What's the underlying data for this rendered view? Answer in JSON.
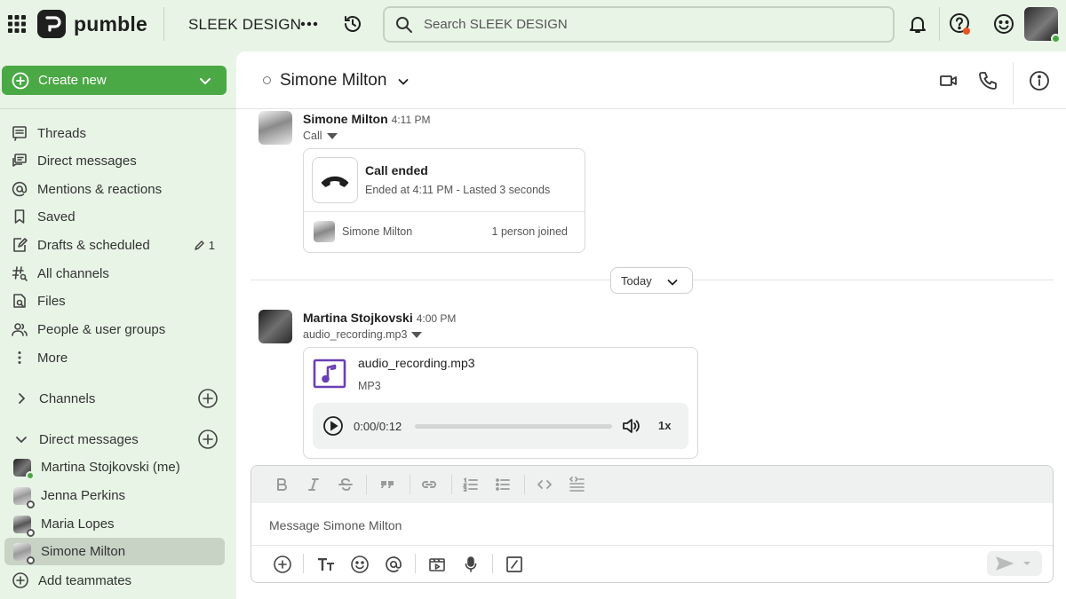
{
  "app": {
    "logo_text": "pumble",
    "workspace": "SLEEK DESIGN"
  },
  "search": {
    "placeholder": "Search SLEEK DESIGN"
  },
  "sidebar": {
    "create_label": "Create new",
    "items": [
      {
        "label": "Threads",
        "icon": "threads-icon"
      },
      {
        "label": "Direct messages",
        "icon": "direct-messages-icon"
      },
      {
        "label": "Mentions & reactions",
        "icon": "at-icon"
      },
      {
        "label": "Saved",
        "icon": "bookmark-icon"
      },
      {
        "label": "Drafts & scheduled",
        "icon": "drafts-icon",
        "badge": "1"
      },
      {
        "label": "All channels",
        "icon": "hash-search-icon"
      },
      {
        "label": "Files",
        "icon": "files-icon"
      },
      {
        "label": "People & user groups",
        "icon": "people-icon"
      },
      {
        "label": "More",
        "icon": "more-vertical-icon"
      }
    ],
    "channels_label": "Channels",
    "dms_label": "Direct messages",
    "dms": [
      {
        "name": "Martina Stojkovski (me)",
        "status": "online"
      },
      {
        "name": "Jenna Perkins",
        "status": "offline"
      },
      {
        "name": "Maria Lopes",
        "status": "offline"
      },
      {
        "name": "Simone Milton",
        "status": "offline",
        "active": true
      }
    ],
    "add_teammates": "Add teammates"
  },
  "channel": {
    "name": "Simone Milton"
  },
  "messages": {
    "m1": {
      "author": "Simone Milton",
      "time": "4:11 PM",
      "sub": "Call",
      "call_title": "Call ended",
      "call_detail": "Ended at 4:11 PM - Lasted 3 seconds",
      "participant": "Simone Milton",
      "joined": "1 person joined"
    },
    "day": "Today",
    "m2": {
      "author": "Martina Stojkovski",
      "time": "4:00 PM",
      "sub": "audio_recording.mp3",
      "file_name": "audio_recording.mp3",
      "file_type": "MP3",
      "player_time": "0:00/0:12",
      "progress": 0,
      "speed": "1x"
    }
  },
  "composer": {
    "placeholder": "Message Simone Milton"
  },
  "colors": {
    "accent": "#4aa845",
    "sidebar_bg": "#e8f5e6",
    "file_icon": "#6a3fb5",
    "notification": "#e8541f"
  }
}
